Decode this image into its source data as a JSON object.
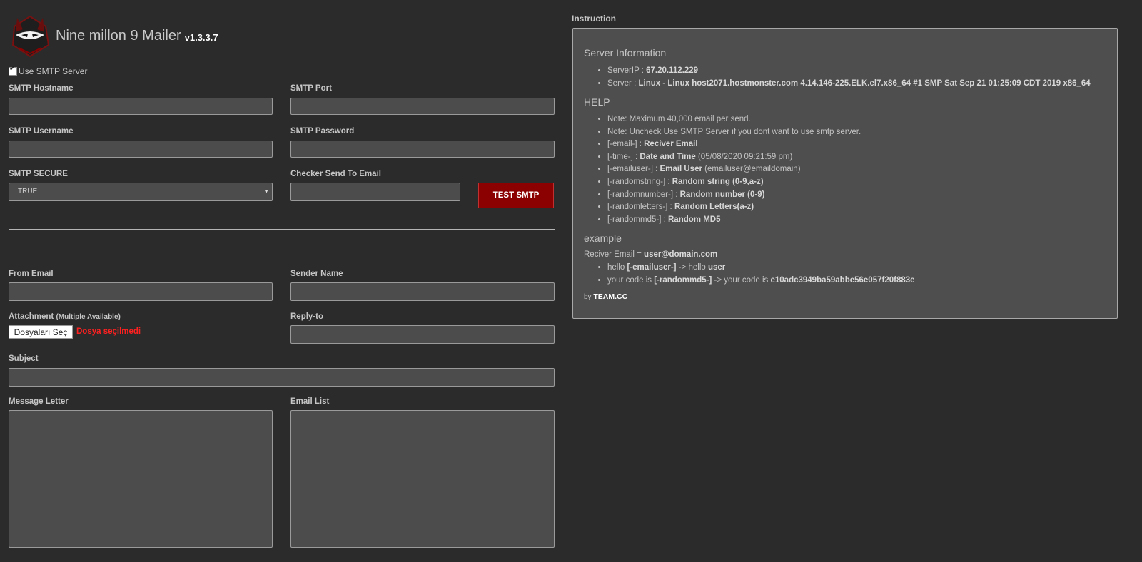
{
  "app": {
    "title": "Nine millon 9 Mailer",
    "version": "v1.3.3.7"
  },
  "form": {
    "use_smtp_label": "Use SMTP Server",
    "use_smtp_checked": true,
    "smtp_hostname_label": "SMTP Hostname",
    "smtp_port_label": "SMTP Port",
    "smtp_username_label": "SMTP Username",
    "smtp_password_label": "SMTP Password",
    "smtp_secure_label": "SMTP SECURE",
    "smtp_secure_value": "TRUE",
    "checker_label": "Checker Send To Email",
    "test_button": "TEST SMTP",
    "from_email_label": "From Email",
    "sender_name_label": "Sender Name",
    "attachment_label": "Attachment",
    "attachment_note": "(Multiple Available)",
    "file_button": "Dosyaları Seç",
    "file_status": "Dosya seçilmedi",
    "reply_to_label": "Reply-to",
    "subject_label": "Subject",
    "message_label": "Message Letter",
    "email_list_label": "Email List"
  },
  "instruction": {
    "title": "Instruction",
    "server_info_heading": "Server Information",
    "server_ip_label": "ServerIP : ",
    "server_ip": "67.20.112.229",
    "server_label": "Server : ",
    "server": "Linux - Linux host2071.hostmonster.com 4.14.146-225.ELK.el7.x86_64 #1 SMP Sat Sep 21 01:25:09 CDT 2019 x86_64",
    "help_heading": "HELP",
    "note1": "Note: Maximum 40,000 email per send.",
    "note2": "Note: Uncheck Use SMTP Server if you dont want to use smtp server.",
    "tags": [
      {
        "tag": "[-email-] : ",
        "desc": "Reciver Email",
        "extra": ""
      },
      {
        "tag": "[-time-] : ",
        "desc": "Date and Time",
        "extra": " (05/08/2020 09:21:59 pm)"
      },
      {
        "tag": "[-emailuser-] : ",
        "desc": "Email User",
        "extra": " (emailuser@emaildomain)"
      },
      {
        "tag": "[-randomstring-] : ",
        "desc": "Random string (0-9,a-z)",
        "extra": ""
      },
      {
        "tag": "[-randomnumber-] : ",
        "desc": "Random number (0-9)",
        "extra": ""
      },
      {
        "tag": "[-randomletters-] : ",
        "desc": "Random Letters(a-z)",
        "extra": ""
      },
      {
        "tag": "[-randommd5-] : ",
        "desc": "Random MD5",
        "extra": ""
      }
    ],
    "example_heading": "example",
    "receiver_label": "Reciver Email = ",
    "receiver_value": "user@domain.com",
    "ex1_pre": "hello ",
    "ex1_tag": "[-emailuser-]",
    "ex1_mid": " -> hello ",
    "ex1_val": "user",
    "ex2_pre": "your code is ",
    "ex2_tag": "[-randommd5-]",
    "ex2_mid": " -> your code is ",
    "ex2_val": "e10adc3949ba59abbe56e057f20f883e",
    "by_label": "by ",
    "by_team": "TEAM.CC"
  }
}
